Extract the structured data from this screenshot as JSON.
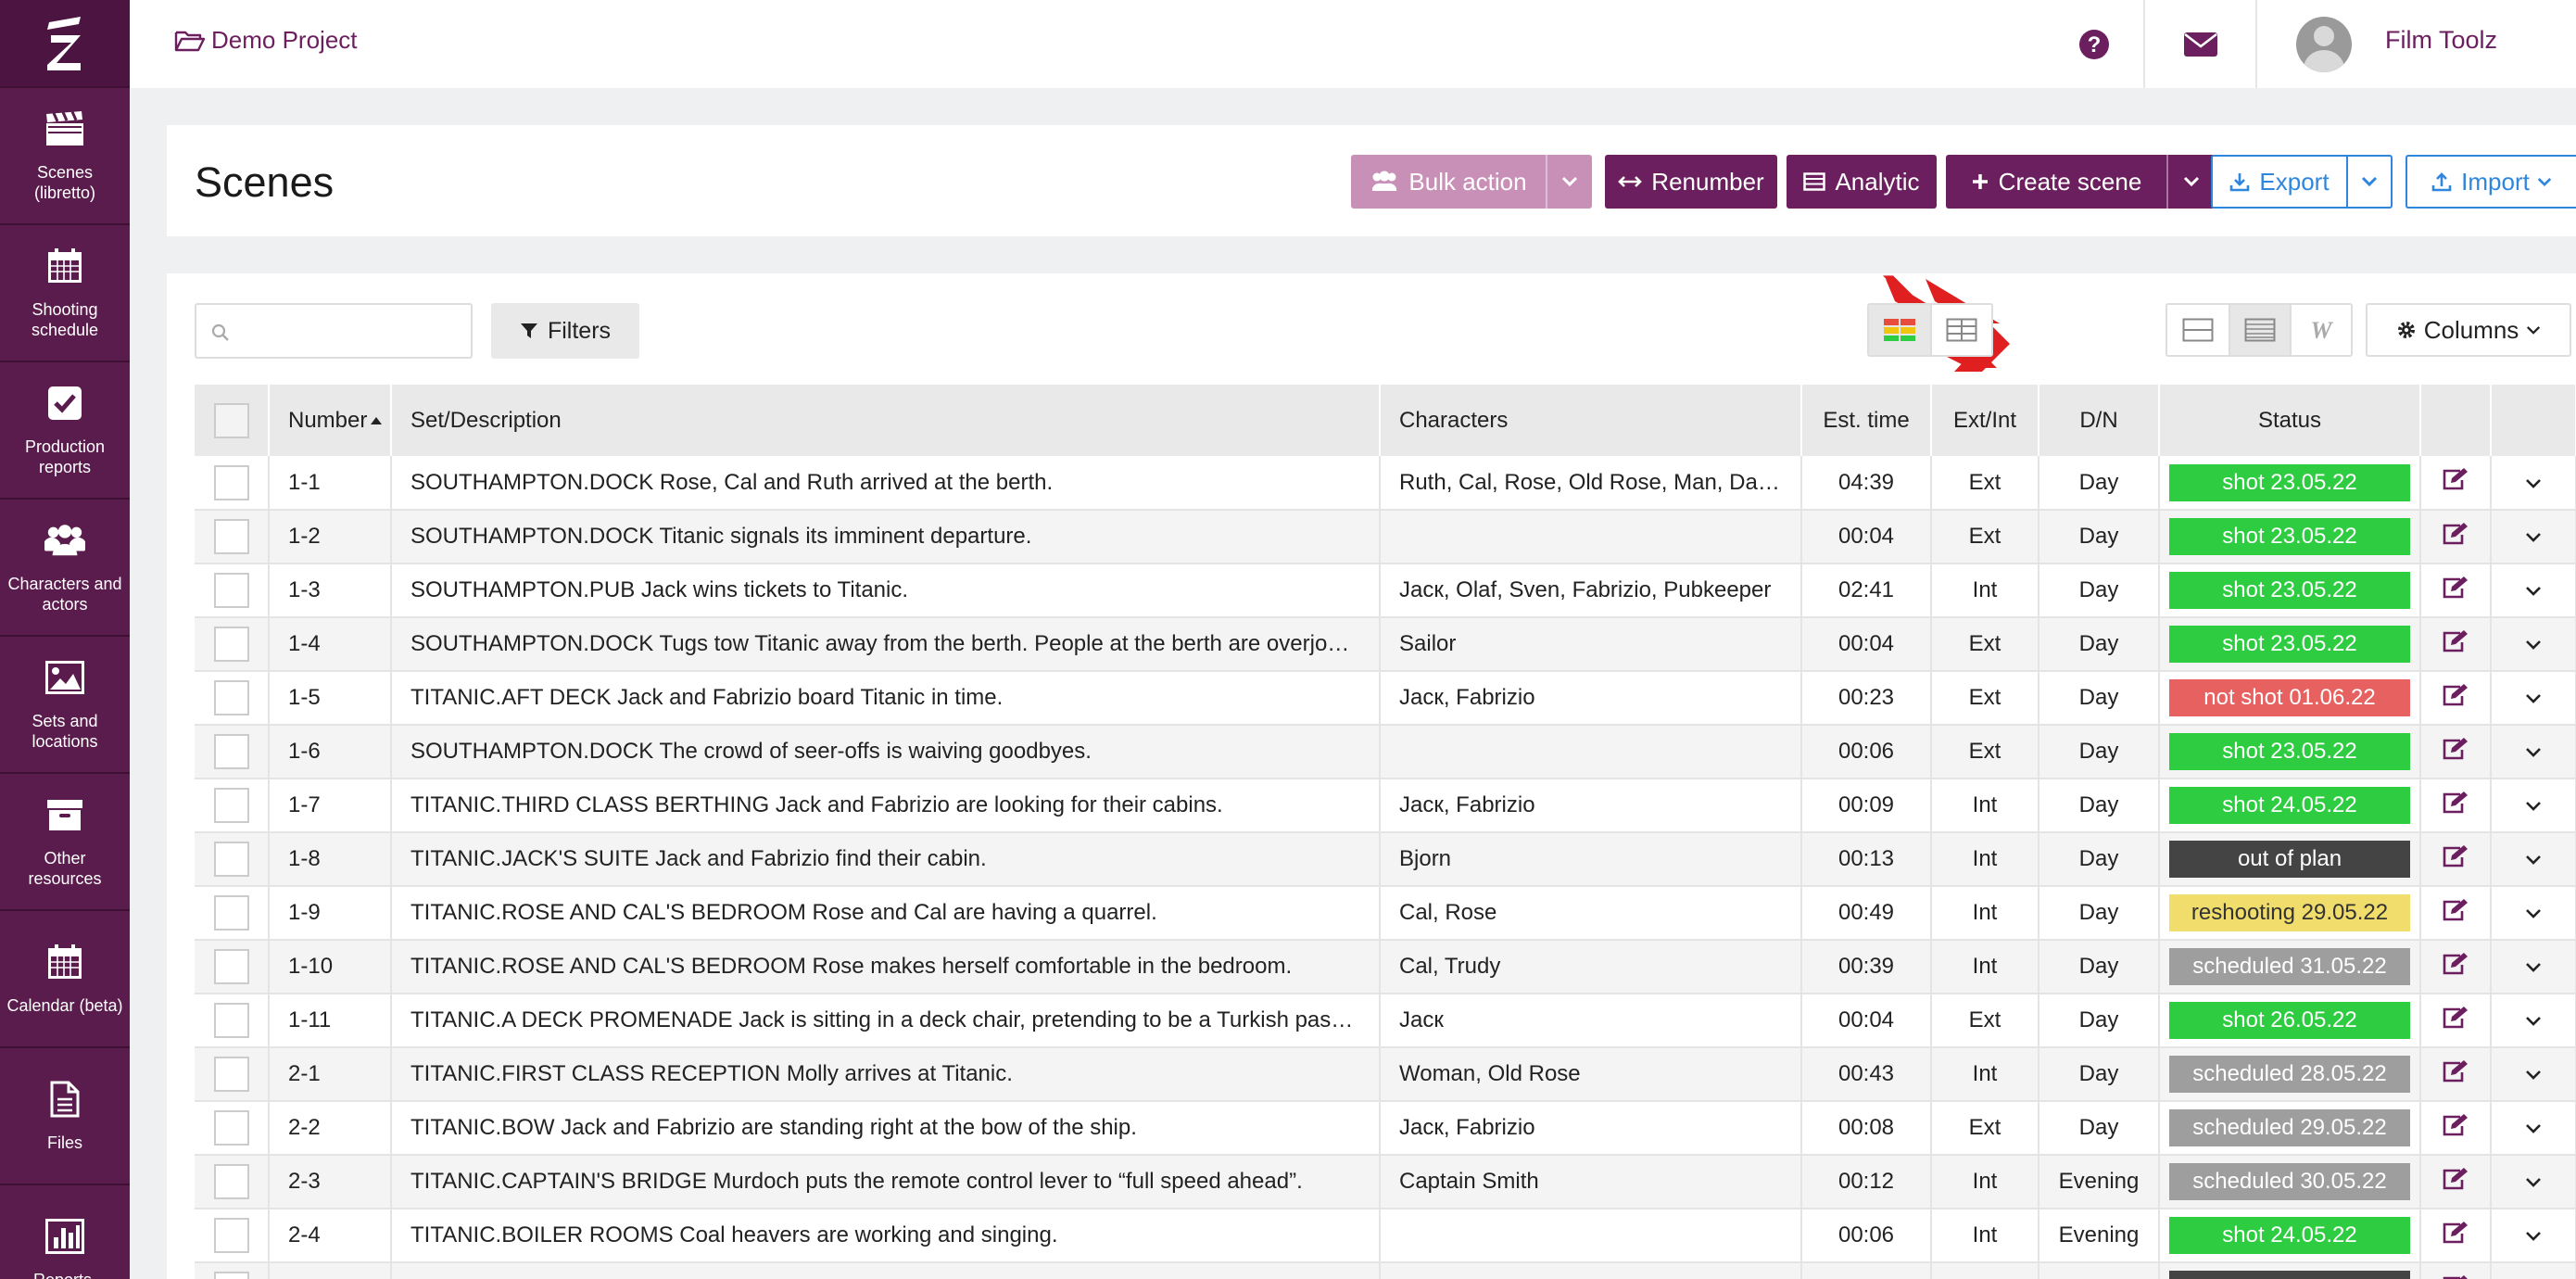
{
  "app": {
    "project": "Demo Project",
    "user_name": "Film Toolz"
  },
  "sidebar": {
    "items": [
      {
        "label": "Scenes (libretto)",
        "icon": "clapperboard-icon"
      },
      {
        "label": "Shooting schedule",
        "icon": "calendar-icon"
      },
      {
        "label": "Production reports",
        "icon": "checkbox-icon"
      },
      {
        "label": "Characters and actors",
        "icon": "users-icon"
      },
      {
        "label": "Sets and locations",
        "icon": "image-icon"
      },
      {
        "label": "Other resources",
        "icon": "archive-icon"
      },
      {
        "label": "Calendar (beta)",
        "icon": "calendar-grid-icon"
      },
      {
        "label": "Files",
        "icon": "file-icon"
      },
      {
        "label": "Reports,",
        "icon": "bar-chart-icon"
      }
    ]
  },
  "header": {
    "title": "Scenes",
    "bulk_action": "Bulk action",
    "renumber": "Renumber",
    "analytic": "Analytic",
    "create_scene": "Create scene",
    "export": "Export",
    "import": "Import"
  },
  "toolbar": {
    "search_placeholder": "",
    "filters": "Filters",
    "columns": "Columns"
  },
  "table": {
    "headers": {
      "number": "Number",
      "set_description": "Set/Description",
      "characters": "Characters",
      "est_time": "Est. time",
      "ext_int": "Ext/Int",
      "dn": "D/N",
      "status": "Status"
    },
    "rows": [
      {
        "number": "1-1",
        "description": "SOUTHAMPTON.DOCK Rose, Cal and Ruth arrived at the berth.",
        "characters": "Ruth, Cal, Rose, Old Rose, Man, Dani…",
        "time": "04:39",
        "ext_int": "Ext",
        "dn": "Day",
        "status": "shot 23.05.22",
        "status_color": "#2ecc40",
        "status_text_color": "#ffffff"
      },
      {
        "number": "1-2",
        "description": "SOUTHAMPTON.DOCK Titanic signals its imminent departure.",
        "characters": "",
        "time": "00:04",
        "ext_int": "Ext",
        "dn": "Day",
        "status": "shot 23.05.22",
        "status_color": "#2ecc40",
        "status_text_color": "#ffffff"
      },
      {
        "number": "1-3",
        "description": "SOUTHAMPTON.PUB Jack wins tickets to Titanic.",
        "characters": "Jacк, Olaf, Sven, Fabrizio, Pubkeeper",
        "time": "02:41",
        "ext_int": "Int",
        "dn": "Day",
        "status": "shot 23.05.22",
        "status_color": "#2ecc40",
        "status_text_color": "#ffffff"
      },
      {
        "number": "1-4",
        "description": "SOUTHAMPTON.DOCK Tugs tow Titanic away from the berth. People at the berth are overjoyed.",
        "characters": "Sailor",
        "time": "00:04",
        "ext_int": "Ext",
        "dn": "Day",
        "status": "shot 23.05.22",
        "status_color": "#2ecc40",
        "status_text_color": "#ffffff"
      },
      {
        "number": "1-5",
        "description": "TITANIC.AFT DECK Jack and Fabrizio board Titanic in time.",
        "characters": "Jacк, Fabrizio",
        "time": "00:23",
        "ext_int": "Ext",
        "dn": "Day",
        "status": "not shot 01.06.22",
        "status_color": "#e86161",
        "status_text_color": "#ffffff"
      },
      {
        "number": "1-6",
        "description": "SOUTHAMPTON.DOCK The crowd of seer-offs is waiving goodbyes.",
        "characters": "",
        "time": "00:06",
        "ext_int": "Ext",
        "dn": "Day",
        "status": "shot 23.05.22",
        "status_color": "#2ecc40",
        "status_text_color": "#ffffff"
      },
      {
        "number": "1-7",
        "description": "TITANIC.THIRD CLASS BERTHING Jack and Fabrizio are looking for their cabins.",
        "characters": "Jacк, Fabrizio",
        "time": "00:09",
        "ext_int": "Int",
        "dn": "Day",
        "status": "shot 24.05.22",
        "status_color": "#2ecc40",
        "status_text_color": "#ffffff"
      },
      {
        "number": "1-8",
        "description": "TITANIC.JACK'S SUITE Jack and Fabrizio find their cabin.",
        "characters": "Bjorn",
        "time": "00:13",
        "ext_int": "Int",
        "dn": "Day",
        "status": "out of plan",
        "status_color": "#444444",
        "status_text_color": "#ffffff"
      },
      {
        "number": "1-9",
        "description": "TITANIC.ROSE AND CAL'S BEDROOM Rose and Cal are having a quarrel.",
        "characters": "Cal, Rose",
        "time": "00:49",
        "ext_int": "Int",
        "dn": "Day",
        "status": "reshooting 29.05.22",
        "status_color": "#f1dd6b",
        "status_text_color": "#333333"
      },
      {
        "number": "1-10",
        "description": "TITANIC.ROSE AND CAL'S BEDROOM Rose makes herself comfortable in the bedroom.",
        "characters": "Cal, Trudy",
        "time": "00:39",
        "ext_int": "Int",
        "dn": "Day",
        "status": "scheduled 31.05.22",
        "status_color": "#9e9e9e",
        "status_text_color": "#ffffff"
      },
      {
        "number": "1-11",
        "description": "TITANIC.A DECK PROMENADE Jack is sitting in a deck chair, pretending to be a Turkish pasha.",
        "characters": "Jacк",
        "time": "00:04",
        "ext_int": "Ext",
        "dn": "Day",
        "status": "shot 26.05.22",
        "status_color": "#2ecc40",
        "status_text_color": "#ffffff"
      },
      {
        "number": "2-1",
        "description": "TITANIC.FIRST CLASS RECEPTION Molly arrives at Titanic.",
        "characters": "Woman, Old Rose",
        "time": "00:43",
        "ext_int": "Int",
        "dn": "Day",
        "status": "scheduled 28.05.22",
        "status_color": "#9e9e9e",
        "status_text_color": "#ffffff"
      },
      {
        "number": "2-2",
        "description": "TITANIC.BOW Jack and Fabrizio are standing right at the bow of the ship.",
        "characters": "Jacк, Fabrizio",
        "time": "00:08",
        "ext_int": "Ext",
        "dn": "Day",
        "status": "scheduled 29.05.22",
        "status_color": "#9e9e9e",
        "status_text_color": "#ffffff"
      },
      {
        "number": "2-3",
        "description": "TITANIC.CAPTAIN'S BRIDGE Murdoch puts the remote control lever to “full speed ahead”.",
        "characters": "Captain Smith",
        "time": "00:12",
        "ext_int": "Int",
        "dn": "Evening",
        "status": "scheduled 30.05.22",
        "status_color": "#9e9e9e",
        "status_text_color": "#ffffff"
      },
      {
        "number": "2-4",
        "description": "TITANIC.BOILER ROOMS Coal heavers are working and singing.",
        "characters": "",
        "time": "00:06",
        "ext_int": "Int",
        "dn": "Evening",
        "status": "shot 24.05.22",
        "status_color": "#2ecc40",
        "status_text_color": "#ffffff"
      },
      {
        "number": "",
        "description": "",
        "characters": "",
        "time": "",
        "ext_int": "",
        "dn": "",
        "status": "",
        "status_color": "#444444",
        "status_text_color": "#ffffff"
      }
    ]
  },
  "colors": {
    "brand": "#5a1b4d",
    "accent": "#6b1f5e",
    "link_blue": "#2e86de",
    "arrow_red": "#e02020"
  }
}
